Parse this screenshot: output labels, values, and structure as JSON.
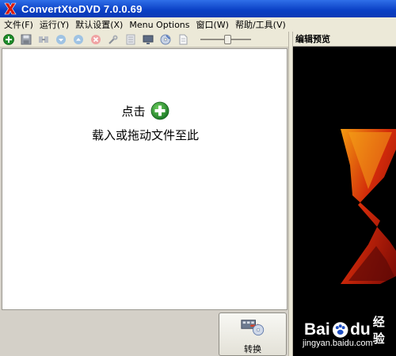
{
  "window": {
    "title": "ConvertXtoDVD 7.0.0.69",
    "icon": "x-logo-icon"
  },
  "menu": [
    {
      "label": "文件(F)"
    },
    {
      "label": "运行(Y)"
    },
    {
      "label": "默认设置(X)"
    },
    {
      "label": "Menu Options"
    },
    {
      "label": "窗口(W)"
    },
    {
      "label": "帮助/工具(V)"
    }
  ],
  "toolbar": {
    "icons": [
      "add-icon",
      "save-icon",
      "merge-icon",
      "move-down-icon",
      "move-up-icon",
      "delete-icon",
      "settings-icon",
      "chapters-icon",
      "monitor-icon",
      "disc-icon",
      "document-icon"
    ],
    "zoom_level": 0.55
  },
  "droparea": {
    "hint_click": "点击",
    "hint_drag": "载入或拖动文件至此"
  },
  "convert_button": {
    "label": "转换"
  },
  "preview": {
    "header": "编辑预览"
  },
  "watermark": {
    "brand": "Bai",
    "brand2": "du",
    "jingyan": "经验",
    "url": "jingyan.baidu.com"
  },
  "colors": {
    "title_bar": "#0a3fc4",
    "accent_red": "#c8180a",
    "accent_orange": "#f08a00",
    "add_green": "#1f8c2a"
  }
}
